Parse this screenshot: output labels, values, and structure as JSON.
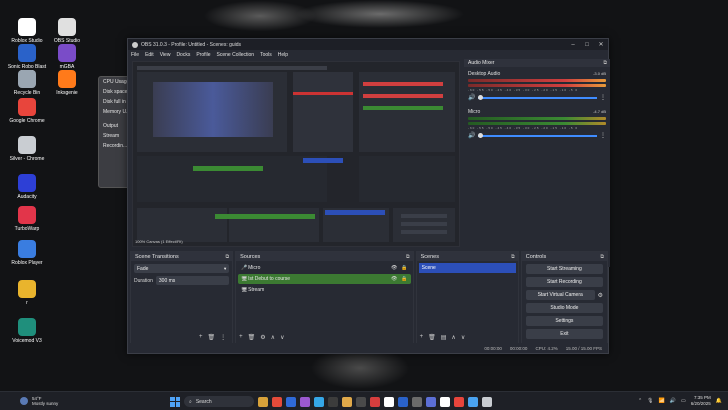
{
  "desktop": {
    "icons": [
      {
        "label": "Roblox Studio",
        "color": "#ffffff"
      },
      {
        "label": "OBS Studio",
        "color": "#e0e0e0"
      },
      {
        "label": "Sonic Robo Blast 2 v2.2",
        "color": "#2a62c9"
      },
      {
        "label": "mGBA",
        "color": "#7a4cc8"
      },
      {
        "label": "Recycle Bin",
        "color": "#9aa6b2"
      },
      {
        "label": "Inksgenie",
        "color": "#ff7a1a"
      },
      {
        "label": "Google Chrome",
        "color": "#e8453c"
      },
      {
        "label": "Silver - Chrome",
        "color": "#c9cdd2"
      },
      {
        "label": "Audacity",
        "color": "#2d3fd6"
      },
      {
        "label": "TurboWarp",
        "color": "#e2354a"
      },
      {
        "label": "Roblox Player",
        "color": "#3a7de0"
      },
      {
        "label": "r",
        "color": "#e9b42d"
      },
      {
        "label": "Voicemod V3",
        "color": "#1f8f7c"
      }
    ]
  },
  "background_window": {
    "lines": [
      "CPU Usage",
      "Disk space",
      "Disk full in",
      "Memory U...",
      "Output",
      "Stream",
      "Recordin..."
    ]
  },
  "obs": {
    "title": "OBS 31.0.3 - Profile: Untitled - Scenes: guids",
    "menu": [
      "File",
      "Edit",
      "View",
      "Docks",
      "Profile",
      "Scene Collection",
      "Tools",
      "Help"
    ],
    "preview_status": "100%   Canvas (1 Effect/Fit)",
    "mixer": {
      "title": "Audio Mixer",
      "channels": [
        {
          "name": "Desktop Audio",
          "db": "-3.0 dB",
          "meter_color": "#d13f3f"
        },
        {
          "name": "Micro",
          "db": "-4.7 dB",
          "meter_color": "#3b8a33"
        }
      ],
      "ticks": "-60 -55 -50 -45 -40 -35 -30 -25 -20 -15 -10 -5 0"
    },
    "transitions": {
      "title": "Scene Transitions",
      "selected": "Fade",
      "duration_label": "Duration",
      "duration_value": "300 ms"
    },
    "sources": {
      "title": "Sources",
      "items": [
        {
          "label": "Micro",
          "icon": "🎤"
        },
        {
          "label": "Ist Debut to course",
          "icon": "🖥"
        },
        {
          "label": "Stream",
          "icon": "🖥"
        }
      ],
      "selected_index": 1
    },
    "scenes": {
      "title": "Scenes",
      "items": [
        "Scene"
      ],
      "selected_index": 0
    },
    "controls": {
      "title": "Controls",
      "buttons": [
        "Start Streaming",
        "Start Recording",
        "Start Virtual Camera",
        "Studio Mode",
        "Settings",
        "Exit"
      ]
    },
    "status": {
      "frames": "00:00:00",
      "rec": "00:00:00",
      "cpu": "CPU: 4.2%",
      "fps": "15.00 / 15.00 FPS"
    }
  },
  "taskbar": {
    "weather_temp": "54°F",
    "weather_desc": "Mostly sunny",
    "search_placeholder": "Search",
    "apps": [
      "#d8a23a",
      "#e44b3a",
      "#2f6ad8",
      "#9b59d0",
      "#35a7e8",
      "#3c3c3c",
      "#e0a94a",
      "#4a4a4a",
      "#d63e3e",
      "#ffffff",
      "#2a62c9",
      "#6b6b6b",
      "#5c6fd6",
      "#ffffff",
      "#e8453c",
      "#4aa3f0",
      "#c9cdd2"
    ],
    "time": "7:35 PM",
    "date": "6/20/2025"
  }
}
